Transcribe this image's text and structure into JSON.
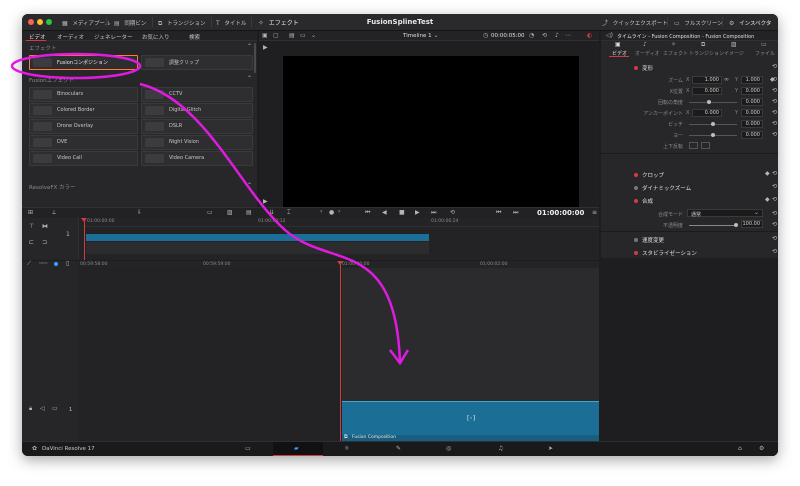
{
  "window": {
    "project_title": "FusionSplineTest"
  },
  "toolbar": {
    "media_pool": "メディアプール",
    "metadata": "同期ビン",
    "transitions": "トランジション",
    "titles": "タイトル",
    "effects": "エフェクト",
    "quick_export": "クイックエクスポート",
    "fullscreen": "フルスクリーン",
    "inspector": "インスペクタ"
  },
  "effects_panel": {
    "tabs": [
      "ビデオ",
      "オーディオ",
      "ジェネレーター",
      "お気に入り",
      "検索"
    ],
    "section_effects": "エフェクト",
    "section_fusion": "Fusionエフェクト",
    "section_resolvefx": "ResolveFX カラー",
    "effects_items": [
      "Fusionコンポジション",
      "調整クリップ"
    ],
    "fusion_items": [
      "Binoculars",
      "CCTV",
      "Colored Border",
      "Digital Glitch",
      "Drone Overlay",
      "DSLR",
      "DVE",
      "Night Vision",
      "Video Call",
      "Video Camera"
    ]
  },
  "viewer": {
    "timeline_name": "Timeline 1",
    "timecode_top": "00:00:05:00",
    "timecode_main": "01:00:00:00"
  },
  "inspector_panel": {
    "header": "タイムライン - Fusion Composition - Fusion Composition",
    "tabs": [
      "ビデオ",
      "オーディオ",
      "エフェクト",
      "トランジション",
      "イメージ",
      "ファイル"
    ],
    "transform_title": "変形",
    "zoom_label": "ズーム",
    "zoom_x": "1.000",
    "zoom_y": "1.000",
    "position_label": "X位置",
    "position_x": "0.000",
    "position_y": "0.000",
    "rotation_label": "回転の角度",
    "rotation_value": "0.000",
    "anchor_label": "アンカーポイント",
    "anchor_x": "0.000",
    "anchor_y": "0.000",
    "pitch_label": "ピッチ",
    "pitch_value": "0.000",
    "yaw_label": "ヨー",
    "yaw_value": "0.000",
    "flip_label": "上下反転",
    "crop_title": "クロップ",
    "dynamic_zoom_title": "ダイナミックズーム",
    "composite_title": "合成",
    "composite_mode_label": "合成モード",
    "composite_mode_value": "通常",
    "opacity_label": "不透明度",
    "opacity_value": "100.00",
    "speed_change_title": "速度変更",
    "stabilization_title": "スタビライゼーション",
    "axis_x": "X",
    "axis_y": "Y"
  },
  "timeline": {
    "upper_ruler": [
      "01:00:00:00",
      "01:00:03:12",
      "01:00:06:24"
    ],
    "lower_ruler": [
      "01:00:00:00",
      "01:00:01:00",
      "01:00:02:00",
      "00:59:58:00",
      "00:59:59:00"
    ],
    "clip_label": "Fusion Composition",
    "clip_center_icon": "[◦]",
    "track_number": "1"
  },
  "bottom_bar": {
    "app_name": "DaVinci Resolve 17"
  },
  "colors": {
    "accent_red": "#d23c3c",
    "clip_blue": "#1b6f97",
    "annotation_magenta": "#e01be0"
  }
}
